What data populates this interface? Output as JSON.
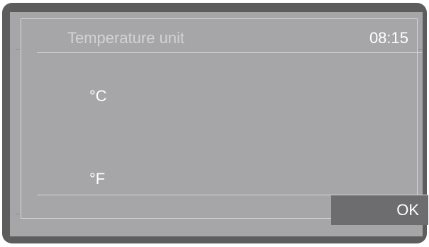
{
  "header": {
    "title": "Temperature unit",
    "time": "08:15"
  },
  "options": [
    {
      "label": "°C"
    },
    {
      "label": "°F"
    }
  ],
  "footer": {
    "ok_label": "OK"
  },
  "colors": {
    "bezel": "#5d5d5e",
    "screen_background": "#a6a6a8",
    "button_background": "#6d6d6f",
    "text": "#ffffff",
    "title_text": "#d3d3d5"
  }
}
